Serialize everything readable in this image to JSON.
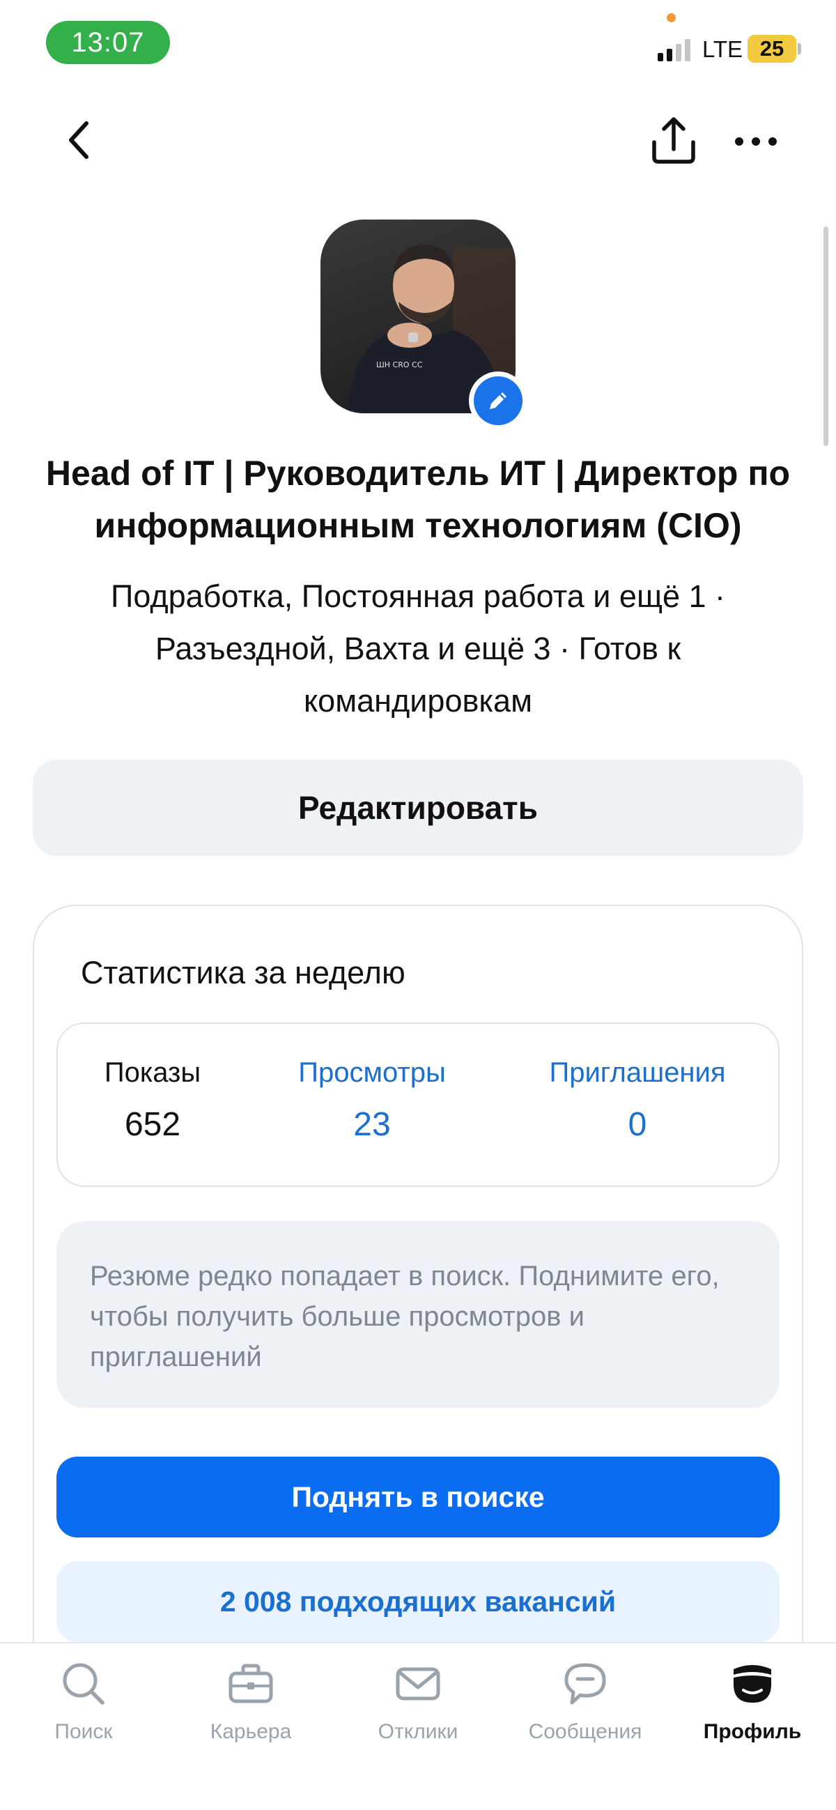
{
  "status_bar": {
    "time": "13:07",
    "network": "LTE",
    "battery": "25"
  },
  "header": {
    "back_icon": "chevron-left-icon",
    "share_icon": "share-icon",
    "more_icon": "more-horizontal-icon"
  },
  "profile": {
    "title": "Head of IT | Руководитель ИТ | Директор по информационным технологиям (CIO)",
    "subtitle": "Подработка, Постоянная работа и ещё 1 · Разъездной, Вахта и ещё 3 · Готов к командировкам",
    "edit_avatar_icon": "pencil-icon"
  },
  "edit_button": "Редактировать",
  "stats": {
    "heading": "Статистика за неделю",
    "items": [
      {
        "label": "Показы",
        "value": "652"
      },
      {
        "label": "Просмотры",
        "value": "23"
      },
      {
        "label": "Приглашения",
        "value": "0"
      }
    ],
    "hint": "Резюме редко попадает в поиск. Поднимите его, чтобы получить больше просмотров и приглашений",
    "raise_button": "Поднять в поиске",
    "vacancies_button": "2 008 подходящих вакансий"
  },
  "tabbar": {
    "items": [
      {
        "label": "Поиск",
        "icon": "search-icon"
      },
      {
        "label": "Карьера",
        "icon": "briefcase-icon"
      },
      {
        "label": "Отклики",
        "icon": "envelope-icon"
      },
      {
        "label": "Сообщения",
        "icon": "chat-icon"
      },
      {
        "label": "Профиль",
        "icon": "profile-icon"
      }
    ],
    "active_index": 4
  },
  "colors": {
    "accent": "#0a6cf0",
    "link": "#1a6fd1",
    "status_green": "#34b04a"
  }
}
